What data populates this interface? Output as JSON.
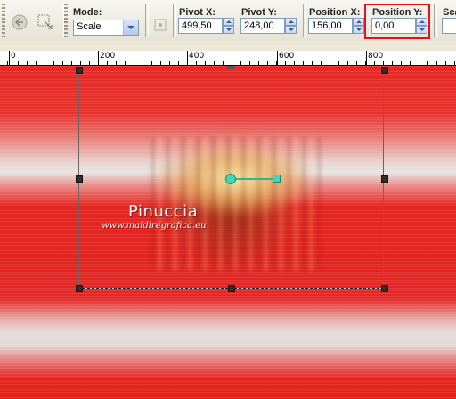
{
  "toolbar": {
    "mode": {
      "label": "Mode:",
      "value": "Scale"
    },
    "pivot_x": {
      "label": "Pivot X:",
      "value": "499,50"
    },
    "pivot_y": {
      "label": "Pivot Y:",
      "value": "248,00"
    },
    "position_x": {
      "label": "Position X:",
      "value": "156,00"
    },
    "position_y": {
      "label": "Position Y:",
      "value": "0,00"
    },
    "scale_label_partial": "Sca",
    "highlight_color": "#e2121b"
  },
  "ruler": {
    "labels": [
      "0",
      "200",
      "400",
      "600",
      "800"
    ]
  },
  "canvas": {
    "watermark_name": "Pinuccia",
    "watermark_url": "www.maidiregrafica.eu",
    "bg_color": "#e52a26",
    "pivot_color": "#3fd8b4"
  }
}
